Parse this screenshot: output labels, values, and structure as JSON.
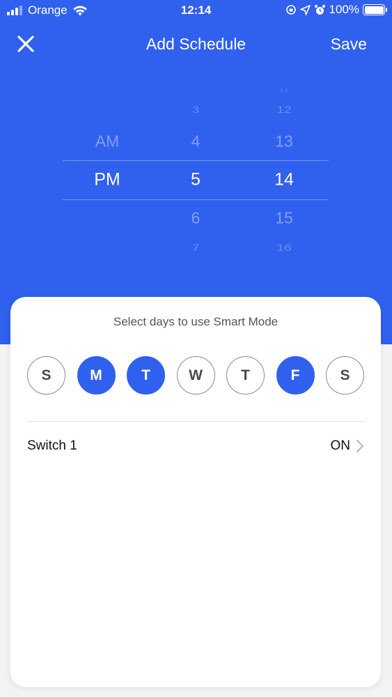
{
  "status_bar": {
    "carrier": "Orange",
    "time": "12:14",
    "battery": "100%"
  },
  "nav": {
    "title": "Add Schedule",
    "save_label": "Save",
    "close_icon": "close-icon"
  },
  "picker": {
    "period": {
      "above": [
        "AM"
      ],
      "selected": "PM",
      "below": []
    },
    "hour": {
      "above": [
        "3",
        "4"
      ],
      "selected": "5",
      "below": [
        "6",
        "7"
      ]
    },
    "minute": {
      "above": [
        "11",
        "12",
        "13"
      ],
      "selected": "14",
      "below": [
        "15",
        "16"
      ]
    }
  },
  "card": {
    "title": "Select days to use Smart Mode",
    "days": [
      {
        "label": "S",
        "selected": false
      },
      {
        "label": "M",
        "selected": true
      },
      {
        "label": "T",
        "selected": true
      },
      {
        "label": "W",
        "selected": false
      },
      {
        "label": "T",
        "selected": false
      },
      {
        "label": "F",
        "selected": true
      },
      {
        "label": "S",
        "selected": false
      }
    ],
    "switch_row": {
      "label": "Switch 1",
      "value": "ON"
    }
  },
  "colors": {
    "primary": "#3060ee",
    "day_border": "#8a8a8a"
  }
}
